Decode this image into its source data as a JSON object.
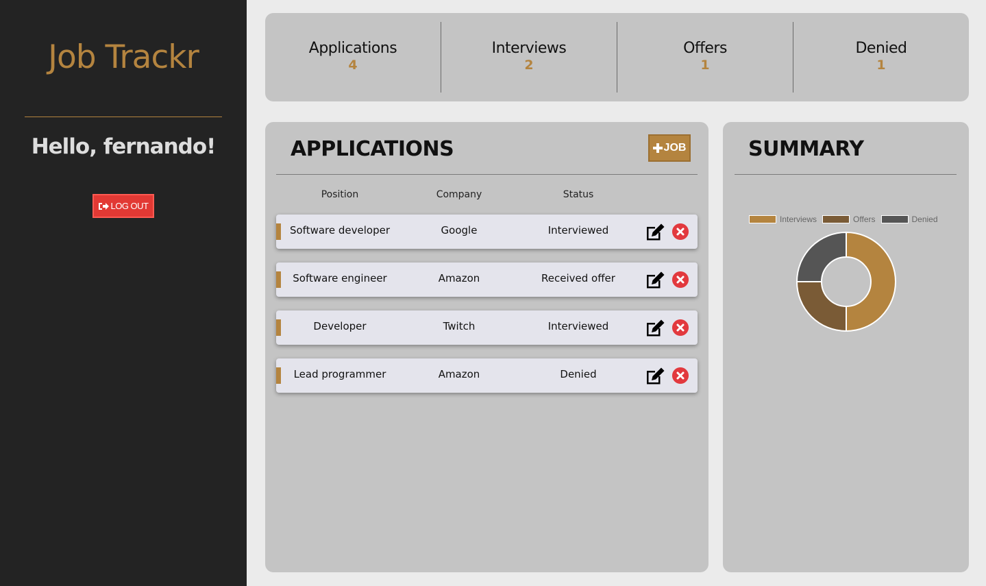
{
  "app": {
    "title": "Job Trackr",
    "greeting": "Hello, fernando!",
    "logout_label": "LOG OUT"
  },
  "stats": [
    {
      "label": "Applications",
      "value": "4"
    },
    {
      "label": "Interviews",
      "value": "2"
    },
    {
      "label": "Offers",
      "value": "1"
    },
    {
      "label": "Denied",
      "value": "1"
    }
  ],
  "applications": {
    "title": "APPLICATIONS",
    "add_label": "JOB",
    "columns": [
      "Position",
      "Company",
      "Status"
    ],
    "rows": [
      {
        "position": "Software developer",
        "company": "Google",
        "status": "Interviewed"
      },
      {
        "position": "Software engineer",
        "company": "Amazon",
        "status": "Received offer"
      },
      {
        "position": "Developer",
        "company": "Twitch",
        "status": "Interviewed"
      },
      {
        "position": "Lead programmer",
        "company": "Amazon",
        "status": "Denied"
      }
    ]
  },
  "summary": {
    "title": "SUMMARY"
  },
  "colors": {
    "accent": "#b4843f",
    "sidebar": "#232323",
    "danger": "#e2393e"
  },
  "chart_data": {
    "type": "pie",
    "legend": "top",
    "categories": [
      "Interviews",
      "Offers",
      "Denied"
    ],
    "values": [
      2,
      1,
      1
    ],
    "colors": [
      "#b4843f",
      "#7a5b36",
      "#555555"
    ]
  }
}
